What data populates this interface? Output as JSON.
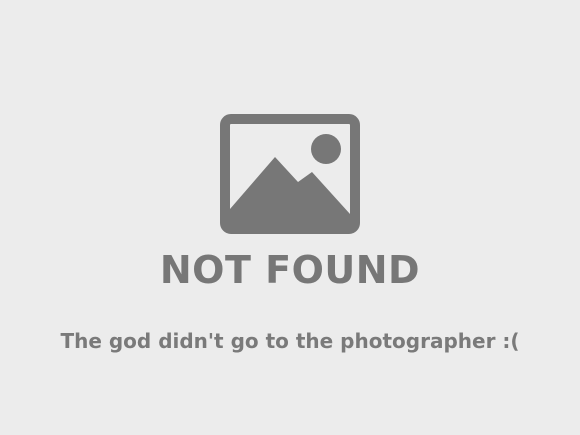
{
  "placeholder": {
    "icon": "image-placeholder-icon",
    "icon_color": "#777777",
    "background_color": "#ececec",
    "headline": "NOT FOUND",
    "message": "The god didn't go to the photographer :("
  }
}
